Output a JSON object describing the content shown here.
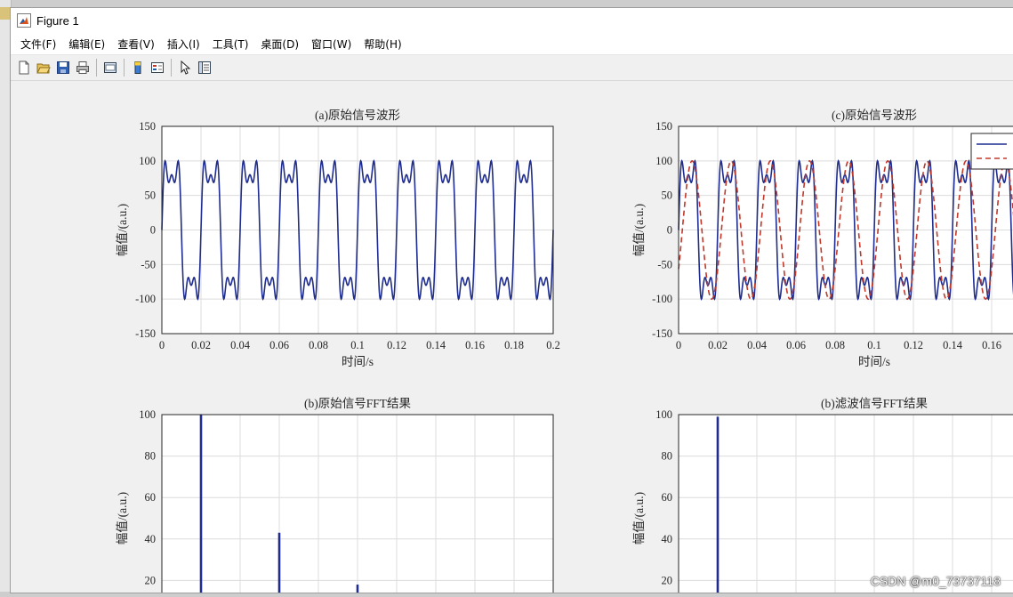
{
  "window": {
    "title": "Figure 1"
  },
  "menu": [
    "文件(F)",
    "编辑(E)",
    "查看(V)",
    "插入(I)",
    "工具(T)",
    "桌面(D)",
    "窗口(W)",
    "帮助(H)"
  ],
  "toolbar": [
    "new-figure-icon",
    "open-file-icon",
    "save-icon",
    "print-icon",
    "link-plot-icon",
    "insert-colorbar-icon",
    "insert-legend-icon",
    "pointer-icon",
    "property-inspector-icon"
  ],
  "watermark": "CSDN @m0_73737118",
  "colors": {
    "signal": "#1f2d8f",
    "filtered": "#c0392b",
    "grid": "#dcdcdc"
  },
  "chart_data": [
    {
      "type": "line",
      "title": "(a)原始信号波形",
      "xlabel": "时间/s",
      "ylabel": "幅值/(a.u.)",
      "xlim": [
        0,
        0.2
      ],
      "ylim": [
        -150,
        150
      ],
      "xticks": [
        "0",
        "0.02",
        "0.04",
        "0.06",
        "0.08",
        "0.1",
        "0.12",
        "0.14",
        "0.16",
        "0.18",
        "0.2"
      ],
      "yticks": [
        "150",
        "100",
        "50",
        "0",
        "-50",
        "-100",
        "-150"
      ],
      "grid": true,
      "series": [
        {
          "formula": "100*sin(2*pi*50*t)+40*sin(2*pi*150*t)+20*sin(2*pi*250*t)",
          "style": "solid",
          "color": "#1f2d8f"
        }
      ]
    },
    {
      "type": "line",
      "title": "(c)原始信号波形",
      "xlabel": "时间/s",
      "ylabel": "幅值/(a.u.)",
      "xlim": [
        0,
        0.2
      ],
      "ylim": [
        -150,
        150
      ],
      "xticks": [
        "0",
        "0.02",
        "0.04",
        "0.06",
        "0.08",
        "0.1",
        "0.12",
        "0.14",
        "0.16"
      ],
      "yticks": [
        "150",
        "100",
        "50",
        "0",
        "-50",
        "-100",
        "-150"
      ],
      "grid": true,
      "legend": "top-right",
      "series": [
        {
          "formula": "100*sin(2*pi*50*t)+40*sin(2*pi*150*t)+20*sin(2*pi*250*t)",
          "style": "solid",
          "color": "#1f2d8f"
        },
        {
          "formula": "100*sin(2*pi*50*t - 0.6)",
          "style": "dashed",
          "color": "#c0392b"
        }
      ]
    },
    {
      "type": "bar",
      "title": "(b)原始信号FFT结果",
      "ylabel": "幅值/(a.u.)",
      "xlim": [
        0,
        0.2
      ],
      "ylim": [
        0,
        100
      ],
      "yticks": [
        "100",
        "80",
        "60",
        "40",
        "20"
      ],
      "grid": true,
      "x": [
        0.02,
        0.06,
        0.1
      ],
      "values": [
        100,
        43,
        18
      ]
    },
    {
      "type": "bar",
      "title": "(b)滤波信号FFT结果",
      "ylabel": "幅值/(a.u.)",
      "xlim": [
        0,
        0.2
      ],
      "ylim": [
        0,
        100
      ],
      "yticks": [
        "100",
        "80",
        "60",
        "40",
        "20"
      ],
      "grid": true,
      "x": [
        0.02
      ],
      "values": [
        99
      ]
    }
  ]
}
